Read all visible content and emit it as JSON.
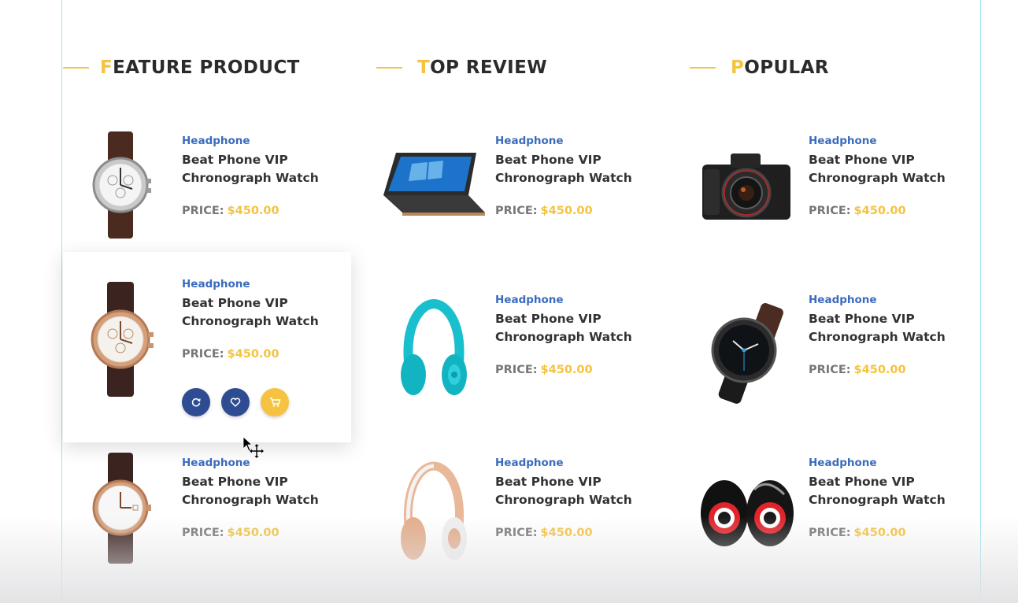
{
  "sections": [
    {
      "title_first": "F",
      "title_rest": "EATURE PRODUCT",
      "products": [
        {
          "image": "silver-chronograph-watch",
          "category": "Headphone",
          "name": "Beat Phone VIP Chronograph Watch",
          "price_label": "PRICE:",
          "price": "$450.00"
        },
        {
          "image": "rose-gold-chronograph-watch",
          "category": "Headphone",
          "name": "Beat Phone VIP Chronograph Watch",
          "price_label": "PRICE:",
          "price": "$450.00"
        },
        {
          "image": "rose-gold-dress-watch",
          "category": "Headphone",
          "name": "Beat Phone VIP Chronograph Watch",
          "price_label": "PRICE:",
          "price": "$450.00"
        }
      ]
    },
    {
      "title_first": "T",
      "title_rest": "OP REVIEW",
      "products": [
        {
          "image": "convertible-laptop",
          "category": "Headphone",
          "name": "Beat Phone VIP Chronograph Watch",
          "price_label": "PRICE:",
          "price": "$450.00"
        },
        {
          "image": "turquoise-headphones",
          "category": "Headphone",
          "name": "Beat Phone VIP Chronograph Watch",
          "price_label": "PRICE:",
          "price": "$450.00"
        },
        {
          "image": "rose-gold-headphones",
          "category": "Headphone",
          "name": "Beat Phone VIP Chronograph Watch",
          "price_label": "PRICE:",
          "price": "$450.00"
        }
      ]
    },
    {
      "title_first": "P",
      "title_rest": "OPULAR",
      "products": [
        {
          "image": "dslr-camera",
          "category": "Headphone",
          "name": "Beat Phone VIP Chronograph Watch",
          "price_label": "PRICE:",
          "price": "$450.00"
        },
        {
          "image": "black-smartwatch",
          "category": "Headphone",
          "name": "Beat Phone VIP Chronograph Watch",
          "price_label": "PRICE:",
          "price": "$450.00"
        },
        {
          "image": "speaker-pair",
          "category": "Headphone",
          "name": "Beat Phone VIP Chronograph Watch",
          "price_label": "PRICE:",
          "price": "$450.00"
        }
      ]
    }
  ],
  "hover_actions": [
    {
      "icon": "refresh-icon"
    },
    {
      "icon": "heart-icon"
    },
    {
      "icon": "cart-icon"
    }
  ],
  "colors": {
    "accent": "#f5c341",
    "category_blue": "#3a6bbd",
    "button_blue": "#2e4c92",
    "heading": "#2b2b2b",
    "guide_line": "#9fe3ee"
  }
}
